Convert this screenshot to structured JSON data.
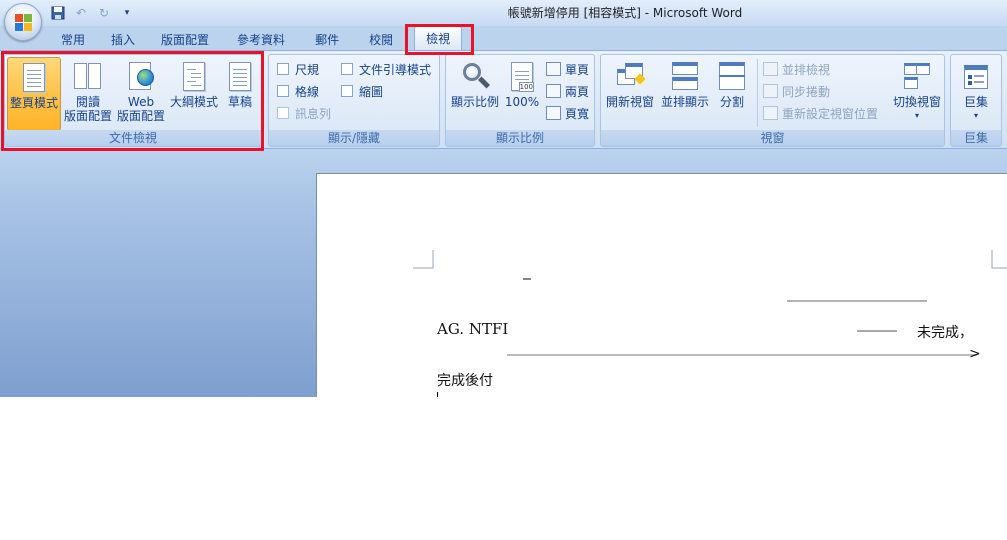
{
  "window": {
    "title": "帳號新增停用 [相容模式] - Microsoft Word"
  },
  "quick_access": {
    "icons": [
      "save-icon",
      "undo-icon",
      "redo-icon",
      "customize-icon"
    ]
  },
  "tabs": [
    {
      "label": "常用"
    },
    {
      "label": "插入"
    },
    {
      "label": "版面配置"
    },
    {
      "label": "參考資料"
    },
    {
      "label": "郵件"
    },
    {
      "label": "校閱"
    },
    {
      "label": "檢視",
      "active": true
    }
  ],
  "ribbon": {
    "doc_views": {
      "group_label": "文件檢視",
      "print_layout": "整頁模式",
      "reading_line1": "閱讀",
      "reading_line2": "版面配置",
      "web_line1": "Web",
      "web_line2": "版面配置",
      "outline": "大綱模式",
      "draft": "草稿"
    },
    "show_hide": {
      "group_label": "顯示/隱藏",
      "ruler": "尺規",
      "gridlines": "格線",
      "message_bar": "訊息列",
      "doc_map": "文件引導模式",
      "thumbnails": "縮圖"
    },
    "zoom": {
      "group_label": "顯示比例",
      "zoom": "顯示比例",
      "hundred": "100%",
      "one_page": "單頁",
      "two_pages": "兩頁",
      "page_width": "頁寬"
    },
    "window": {
      "group_label": "視窗",
      "new_window": "開新視窗",
      "arrange_all": "並排顯示",
      "split": "分割",
      "view_side_by_side": "並排檢視",
      "sync_scroll": "同步捲動",
      "reset_position": "重新設定視窗位置",
      "switch_windows": "切換視窗"
    },
    "macros": {
      "group_label": "巨集",
      "macros": "巨集"
    }
  },
  "document": {
    "line1": "AG. NTFI",
    "line1_end": "未完成，",
    "line2_end": ">",
    "line3": "完成後付"
  }
}
